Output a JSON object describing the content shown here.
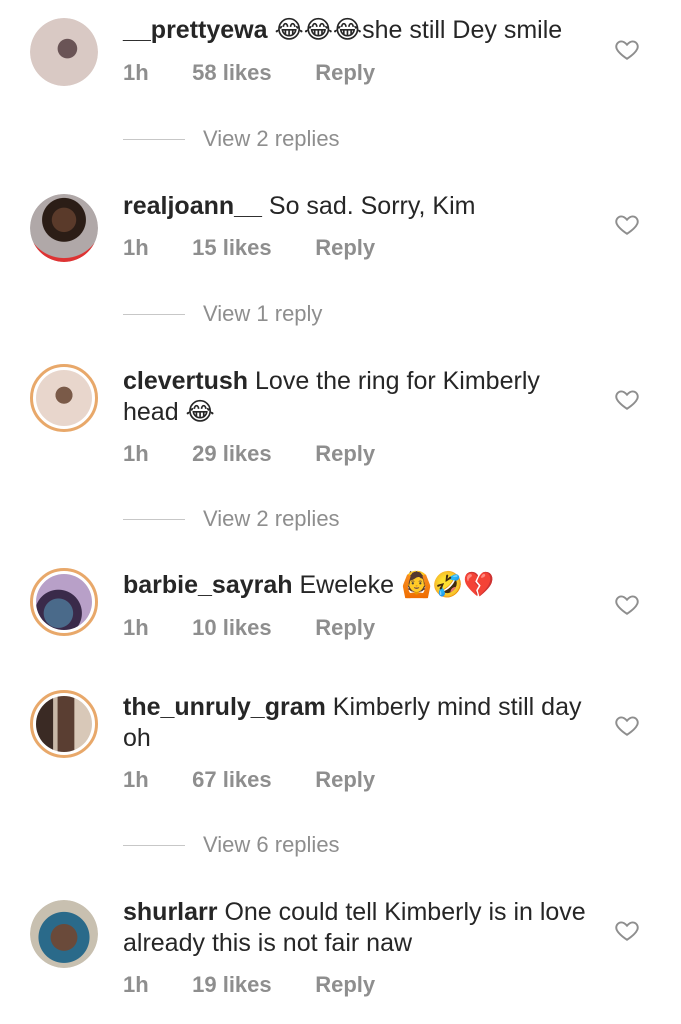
{
  "comments": [
    {
      "username": "__prettyewa",
      "text": "😂😂😂she still Dey smile",
      "time": "1h",
      "likes": "58 likes",
      "reply": "Reply",
      "view_replies": "View 2 replies"
    },
    {
      "username": "realjoann__",
      "text": "So sad. Sorry, Kim",
      "time": "1h",
      "likes": "15 likes",
      "reply": "Reply",
      "view_replies": "View 1 reply"
    },
    {
      "username": "clevertush",
      "text": "Love the ring for Kimberly head 😂",
      "time": "1h",
      "likes": "29 likes",
      "reply": "Reply",
      "view_replies": "View 2 replies"
    },
    {
      "username": "barbie_sayrah",
      "text": "Eweleke 🙆🤣💔",
      "time": "1h",
      "likes": "10 likes",
      "reply": "Reply"
    },
    {
      "username": "the_unruly_gram",
      "text": "Kimberly mind still day oh",
      "time": "1h",
      "likes": "67 likes",
      "reply": "Reply",
      "view_replies": "View 6 replies"
    },
    {
      "username": "shurlarr",
      "text": "One could tell Kimberly is in love already this is not fair naw",
      "time": "1h",
      "likes": "19 likes",
      "reply": "Reply"
    }
  ],
  "colors": {
    "meta": "#8e8e8e",
    "story_ring": "#e8a86a",
    "text": "#262626"
  },
  "icons": {
    "like": "heart-outline-icon"
  }
}
